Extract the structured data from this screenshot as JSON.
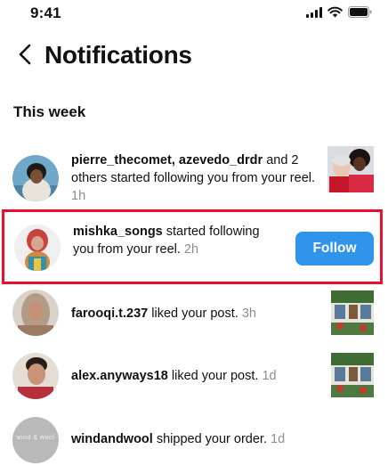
{
  "status_bar": {
    "time": "9:41"
  },
  "header": {
    "title": "Notifications"
  },
  "section": {
    "title": "This week"
  },
  "notifications": [
    {
      "user": "pierre_thecomet",
      "separator": ", ",
      "user2": "azevedo_drdr",
      "text": " and 2 others started following you from your reel.",
      "time": "1h"
    },
    {
      "user": "mishka_songs",
      "text": " started following you from your reel.",
      "time": "2h",
      "action": "Follow"
    },
    {
      "user": "farooqi.t.237",
      "text": " liked your post.",
      "time": "3h"
    },
    {
      "user": "alex.anyways18",
      "text": " liked your post.",
      "time": "1d"
    },
    {
      "user": "windandwool",
      "text": " shipped your order.",
      "time": "1d",
      "avatar_text": "wind & wool"
    }
  ],
  "colors": {
    "accent": "#2f94ea",
    "highlight": "#e8102b",
    "muted": "#8e8e8e"
  },
  "icons": {
    "back": "chevron-left-icon",
    "signal": "cellular-signal-icon",
    "wifi": "wifi-icon",
    "battery": "battery-icon"
  }
}
